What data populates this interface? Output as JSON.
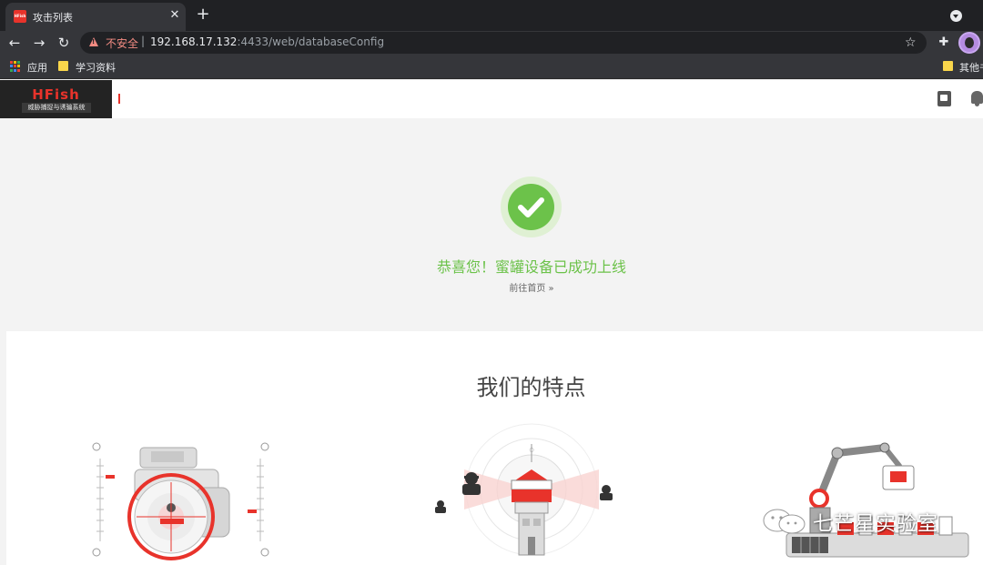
{
  "browser": {
    "tab_title": "攻击列表",
    "tab_favicon_text": "HFish",
    "insecure_label": "不安全",
    "separator": "|",
    "url_host": "192.168.17.132",
    "url_rest": ":4433/web/databaseConfig",
    "bookmarks": [
      {
        "label": "应用"
      },
      {
        "label": "学习资料"
      },
      {
        "label": "其他书"
      }
    ]
  },
  "app": {
    "logo_title": "HFish",
    "logo_subtitle": "威胁捕捉与诱骗系统"
  },
  "success": {
    "message": "恭喜您！蜜罐设备已成功上线",
    "home_link": "前往首页 »"
  },
  "features": {
    "title": "我们的特点"
  },
  "watermark": {
    "text": "七芒星实验室"
  },
  "colors": {
    "brand_red": "#e8332b",
    "success_green": "#6cc24a"
  }
}
